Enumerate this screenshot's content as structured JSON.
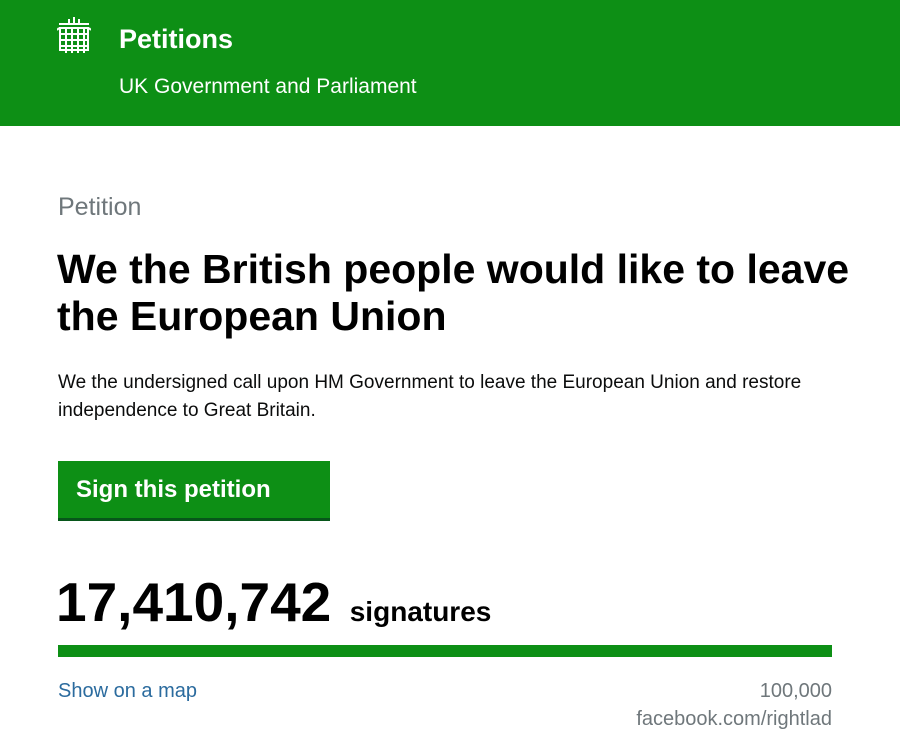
{
  "header": {
    "crest_icon": "portcullis-icon",
    "title": "Petitions",
    "subtitle": "UK Government and Parliament",
    "background_color": "#0d8f15"
  },
  "petition": {
    "caption": "Petition",
    "title": "We the British people would like to leave the European Union",
    "description": "We the undersigned call upon HM Government to leave the European Union and restore independence to Great Britain.",
    "sign_button_label": "Sign this petition",
    "signature_count": "17,410,742",
    "signature_label": "signatures",
    "progress_fraction": 1.0,
    "map_link_label": "Show on a map",
    "threshold": "100,000"
  },
  "watermark": "facebook.com/rightlad",
  "colors": {
    "accent_green": "#0d8f15",
    "link_blue": "#2b6b9e",
    "muted_grey": "#6f777b"
  }
}
